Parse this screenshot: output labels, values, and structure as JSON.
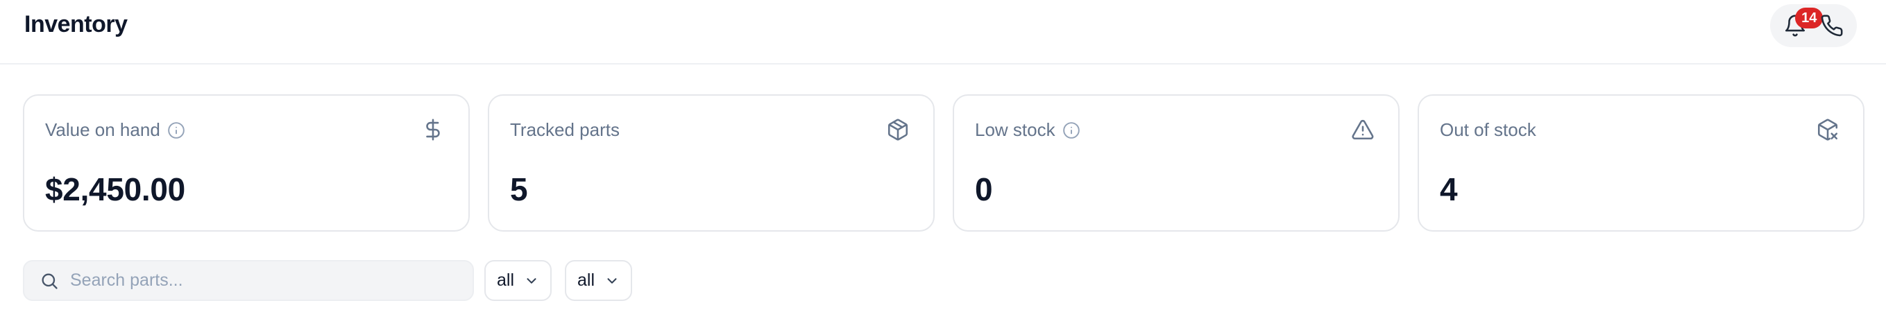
{
  "header": {
    "title": "Inventory",
    "notifications": {
      "icon": "bell-icon",
      "count": "14"
    },
    "phone": {
      "icon": "phone-icon"
    }
  },
  "stats": [
    {
      "label": "Value on hand",
      "value": "$2,450.00",
      "info": true,
      "icon": "dollar-icon"
    },
    {
      "label": "Tracked parts",
      "value": "5",
      "info": false,
      "icon": "package-icon"
    },
    {
      "label": "Low stock",
      "value": "0",
      "info": true,
      "icon": "alert-triangle-icon"
    },
    {
      "label": "Out of stock",
      "value": "4",
      "info": false,
      "icon": "package-x-icon"
    }
  ],
  "toolbar": {
    "search": {
      "placeholder": "Search parts...",
      "value": ""
    },
    "filter1": {
      "value": "all"
    },
    "filter2": {
      "value": "all"
    }
  },
  "colors": {
    "badge": "#dc2626",
    "text": "#0f172a",
    "muted": "#64748b",
    "border": "#e5e7eb"
  }
}
